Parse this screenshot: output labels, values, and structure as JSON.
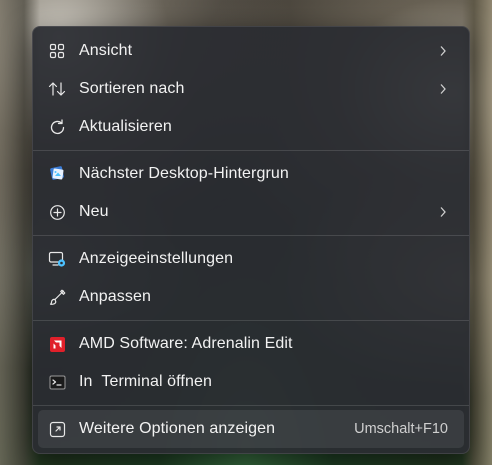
{
  "context_menu": {
    "items": [
      {
        "label": "Ansicht",
        "icon": "view-grid-icon",
        "has_submenu": true
      },
      {
        "label": "Sortieren nach",
        "icon": "sort-icon",
        "has_submenu": true
      },
      {
        "label": "Aktualisieren",
        "icon": "refresh-icon",
        "has_submenu": false
      },
      {
        "label": "Nächster Desktop-Hintergrun",
        "icon": "next-wallpaper-icon",
        "has_submenu": false
      },
      {
        "label": "Neu",
        "icon": "new-plus-icon",
        "has_submenu": true
      },
      {
        "label": "Anzeigeeinstellungen",
        "icon": "display-settings-icon",
        "has_submenu": false
      },
      {
        "label": "Anpassen",
        "icon": "personalize-brush-icon",
        "has_submenu": false
      },
      {
        "label": "AMD Software: Adrenalin Edit",
        "icon": "amd-logo-icon",
        "has_submenu": false
      },
      {
        "label": "In  Terminal öffnen",
        "icon": "terminal-icon",
        "has_submenu": false
      },
      {
        "label": "Weitere Optionen anzeigen",
        "icon": "more-options-icon",
        "has_submenu": false,
        "shortcut": "Umschalt+F10",
        "highlighted": true
      }
    ]
  },
  "colors": {
    "menu_background": "#2a2c32",
    "text": "#f2f2f2",
    "accent_blue": "#4cc2ff",
    "amd_red": "#e0202a"
  }
}
